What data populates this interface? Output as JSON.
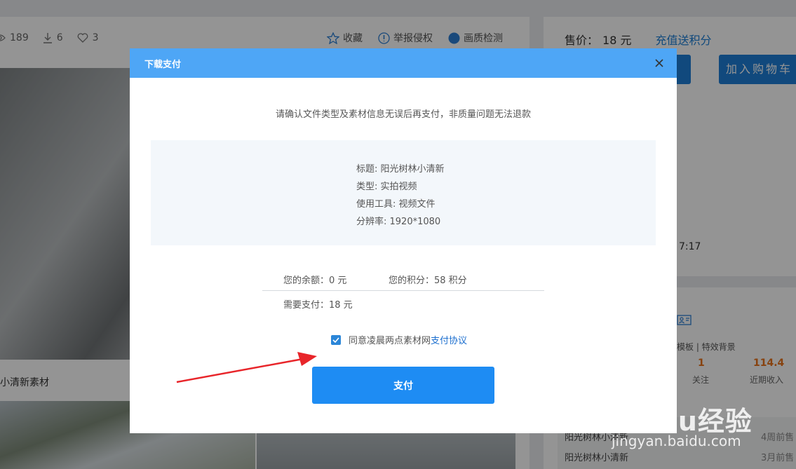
{
  "background": {
    "stats": {
      "views": "189",
      "downloads": "6",
      "likes": "3"
    },
    "actions": {
      "favorite": "收藏",
      "report": "举报侵权",
      "quality": "画质检测"
    },
    "preview_caption": "小清新素材",
    "price": {
      "label": "售价：",
      "value": "18 元",
      "recharge_link": "充值送积分"
    },
    "cart_button": "加入购物车",
    "time_fragment": "7:17",
    "author": {
      "tags": "模板 | 特效背景",
      "follow_value": "1",
      "follow_label": "关注",
      "income_value": "114.4",
      "income_label": "近期收入"
    },
    "recent": [
      {
        "name": "阳光树林小清新",
        "time": "4周前售"
      },
      {
        "name": "阳光树林小清新",
        "time": "3月前售"
      }
    ]
  },
  "modal": {
    "title": "下载支付",
    "notice": "请确认文件类型及素材信息无误后再支付，非质量问题无法退款",
    "info": {
      "title": "标题: 阳光树林小清新",
      "type": "类型: 实拍视频",
      "tool": "使用工具: 视频文件",
      "resolution": "分辨率: 1920*1080"
    },
    "balance": "您的余额：0 元",
    "points": "您的积分：58 积分",
    "need_pay": "需要支付：18 元",
    "agreement_prefix": "同意凌晨两点素材网",
    "agreement_link": "支付协议",
    "agreement_checked": true,
    "pay_button": "支付"
  },
  "watermark": {
    "brand": "Baidu经验",
    "url": "jingyan.baidu.com"
  },
  "colors": {
    "header": "#4ea6f6",
    "pay_button": "#1e8cf3",
    "link": "#1c6fcf",
    "arrow": "#e8252a",
    "accent_orange": "#e8731a"
  }
}
